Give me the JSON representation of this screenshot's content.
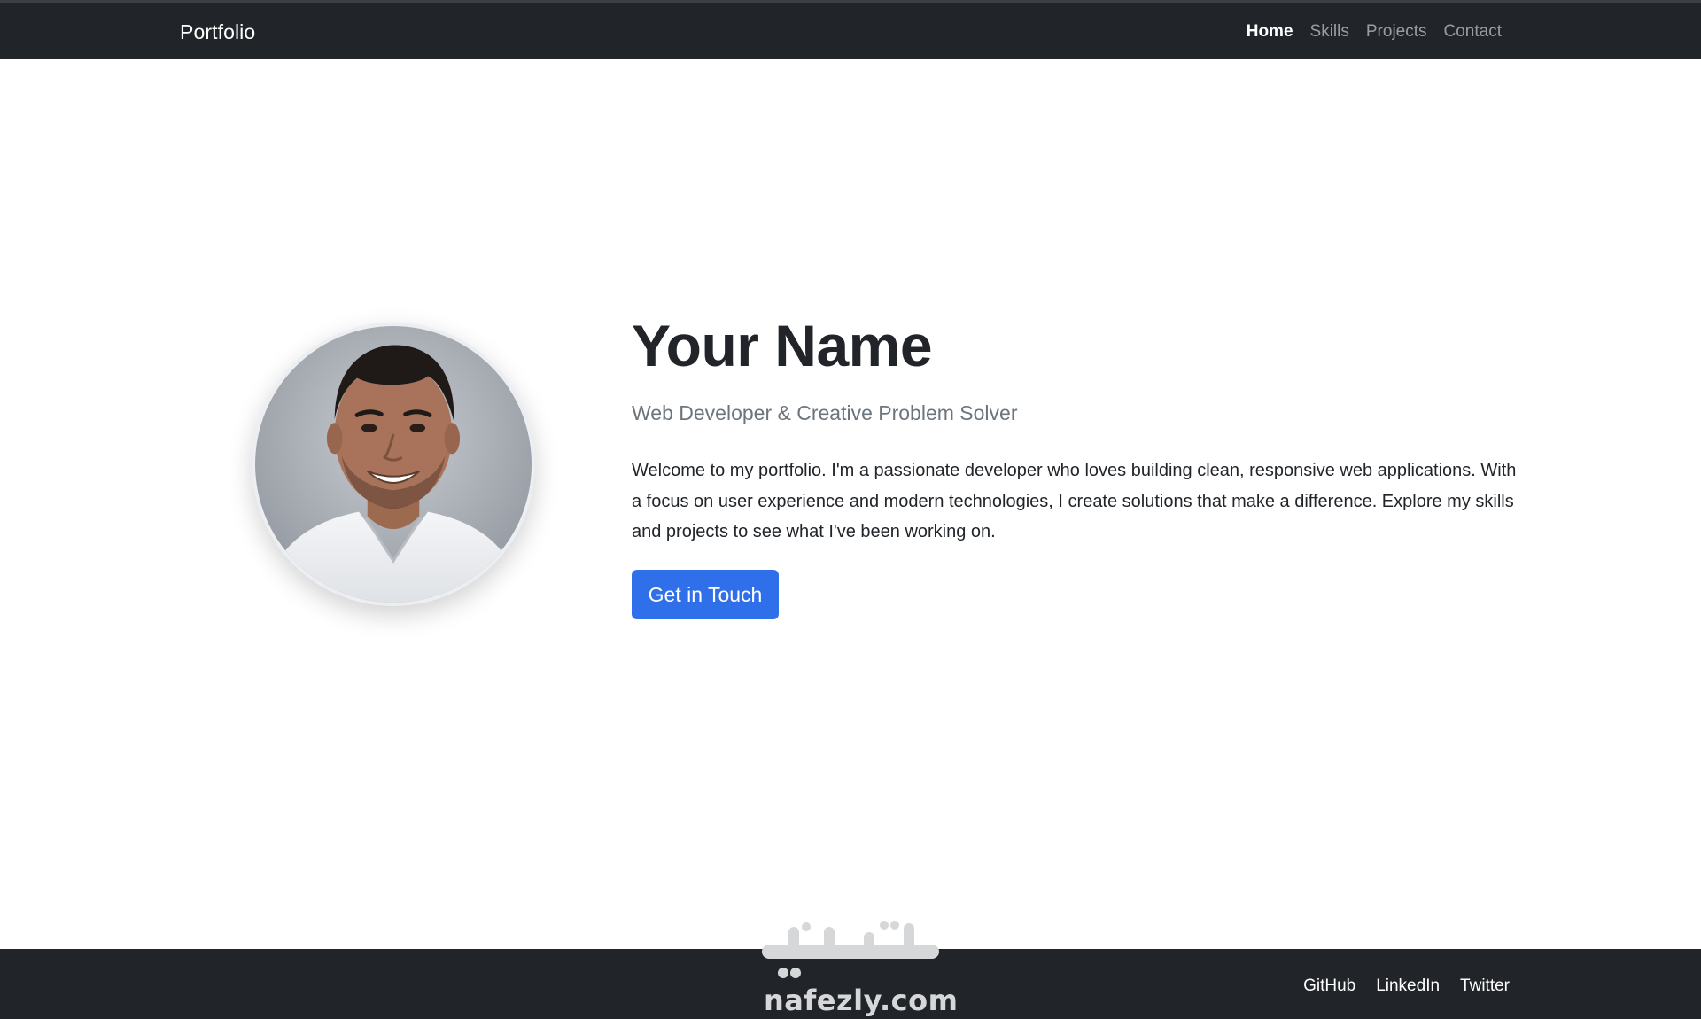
{
  "navbar": {
    "brand": "Portfolio",
    "links": [
      {
        "label": "Home",
        "active": true
      },
      {
        "label": "Skills",
        "active": false
      },
      {
        "label": "Projects",
        "active": false
      },
      {
        "label": "Contact",
        "active": false
      }
    ]
  },
  "hero": {
    "avatar_icon": "profile-photo",
    "title": "Your Name",
    "subtitle": "Web Developer & Creative Problem Solver",
    "bio": "Welcome to my portfolio. I'm a passionate developer who loves building clean, responsive web applications. With a focus on user experience and modern technologies, I create solutions that make a difference. Explore my skills and projects to see what I've been working on.",
    "cta_label": "Get in Touch"
  },
  "footer": {
    "links": [
      "GitHub",
      "LinkedIn",
      "Twitter"
    ]
  },
  "watermark": {
    "arabic": "نفذلي",
    "latin": "nafezly.com"
  },
  "colors": {
    "navbar_bg": "#212529",
    "accent": "#2f6fea",
    "muted_text": "#6c757d",
    "body_text": "#212529"
  }
}
